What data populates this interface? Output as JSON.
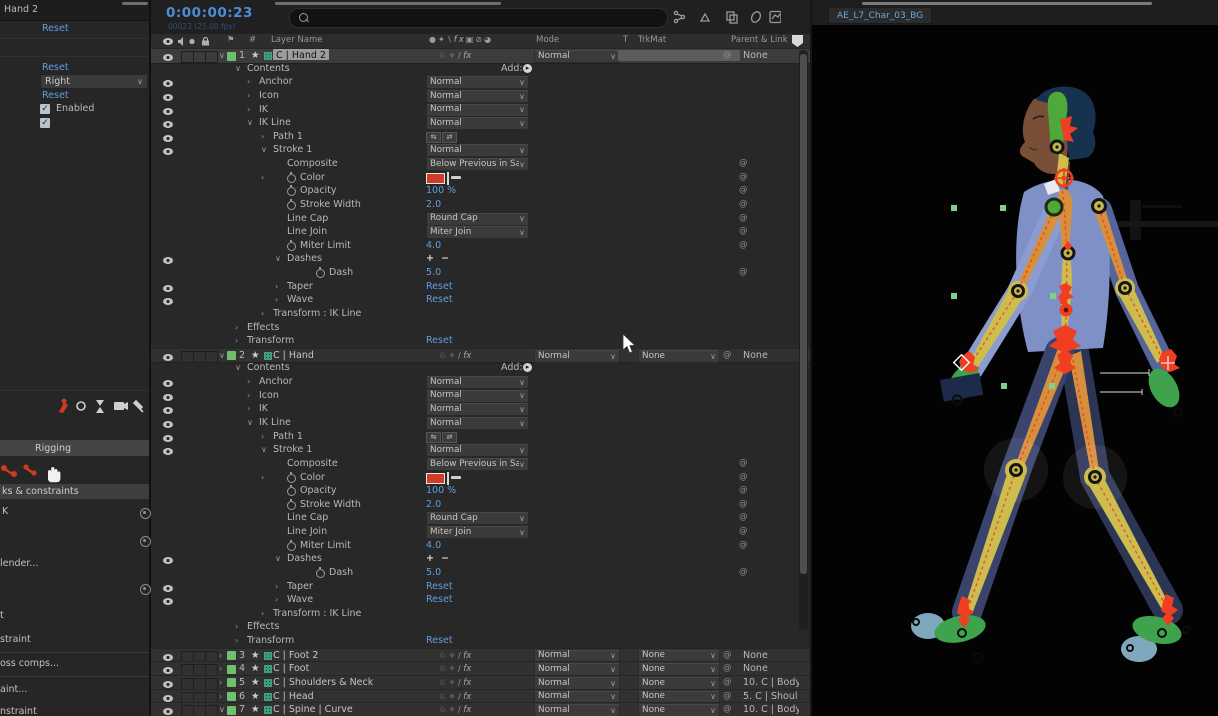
{
  "colors": {
    "accent_blue": "#4a8fd6",
    "value_blue": "#5f9fe0",
    "label_green": "#6fbf6f",
    "stroke_red": "#d23a2a",
    "controller_red": "#f03e22",
    "bone_orange": "#d68f3c",
    "bone_yellow": "#cdbc4e",
    "bone_green": "#4ea83a",
    "foot_green": "#3fa34d",
    "heel_blue": "#7fa8bd",
    "suit_blue": "#7e90c6"
  },
  "left_panel": {
    "title": "Hand 2",
    "reset1": "Reset",
    "reset2": "Reset",
    "reset3": "Reset",
    "dropdown_value": "Right",
    "checkbox_label": "Enabled",
    "tab_rigging": "Rigging",
    "tab_links": "ks & constraints",
    "items": [
      {
        "label": "K"
      },
      {
        "label": ""
      },
      {
        "label": "lender..."
      },
      {
        "label": ""
      },
      {
        "label": "t"
      },
      {
        "label": "straint"
      },
      {
        "label": "oss comps..."
      },
      {
        "label": "aint..."
      },
      {
        "label": "nstraint"
      }
    ]
  },
  "timeline": {
    "timecode": "0:00:00:23",
    "timecode_sub": "00023 (25.00 fps)",
    "columns": {
      "layer_name": "Layer Name",
      "mode": "Mode",
      "t": "T",
      "trkmat": "TrkMat",
      "parent": "Parent & Link",
      "hash": "#"
    },
    "add_label": "Add:",
    "rows": [
      {
        "t": "layer",
        "n": "1",
        "l": "C | Hand 2",
        "sel": true,
        "e": true,
        "tw": "open",
        "m": "Normal",
        "tksel": true,
        "pr": "None"
      },
      {
        "t": "contents",
        "l": "Contents",
        "tw": "open",
        "add": true
      },
      {
        "t": "group",
        "l": "Anchor",
        "i": "c3",
        "e": true,
        "tw": "closed",
        "v": {
          "k": "mode",
          "x": "Normal"
        }
      },
      {
        "t": "group",
        "l": "Icon",
        "i": "c3",
        "e": true,
        "tw": "closed",
        "v": {
          "k": "mode",
          "x": "Normal"
        }
      },
      {
        "t": "group",
        "l": "IK",
        "i": "c3",
        "e": true,
        "tw": "closed",
        "v": {
          "k": "mode",
          "x": "Normal"
        }
      },
      {
        "t": "group",
        "l": "IK Line",
        "i": "c3",
        "e": true,
        "tw": "open",
        "v": {
          "k": "mode",
          "x": "Normal"
        }
      },
      {
        "t": "group",
        "l": "Path 1",
        "i": "c4",
        "e": true,
        "tw": "closed",
        "v": {
          "k": "path"
        }
      },
      {
        "t": "group",
        "l": "Stroke 1",
        "i": "c4",
        "e": true,
        "tw": "open",
        "v": {
          "k": "mode",
          "x": "Normal"
        }
      },
      {
        "t": "prop",
        "l": "Composite",
        "i": "c5",
        "v": {
          "k": "dd",
          "x": "Below Previous in Sa"
        },
        "p": true
      },
      {
        "t": "prop",
        "l": "Color",
        "i": "c5",
        "tw": "closed",
        "sw": true,
        "v": {
          "k": "swatch"
        },
        "p": true
      },
      {
        "t": "prop",
        "l": "Opacity",
        "i": "c5",
        "sw": true,
        "v": {
          "k": "num",
          "x": "100 %"
        },
        "p": true
      },
      {
        "t": "prop",
        "l": "Stroke Width",
        "i": "c5",
        "sw": true,
        "v": {
          "k": "num",
          "x": "2.0"
        },
        "p": true
      },
      {
        "t": "prop",
        "l": "Line Cap",
        "i": "c5",
        "v": {
          "k": "dd",
          "x": "Round Cap"
        },
        "p": true
      },
      {
        "t": "prop",
        "l": "Line Join",
        "i": "c5",
        "v": {
          "k": "dd",
          "x": "Miter Join"
        },
        "p": true
      },
      {
        "t": "prop",
        "l": "Miter Limit",
        "i": "c5",
        "sw": true,
        "v": {
          "k": "num",
          "x": "4.0"
        },
        "p": true
      },
      {
        "t": "group",
        "l": "Dashes",
        "i": "c5",
        "e": true,
        "tw": "open",
        "v": {
          "k": "pm"
        }
      },
      {
        "t": "prop",
        "l": "Dash",
        "i": "c6",
        "sw": true,
        "v": {
          "k": "num",
          "x": "5.0"
        },
        "p": true
      },
      {
        "t": "group",
        "l": "Taper",
        "i": "c5",
        "e": true,
        "tw": "closed",
        "v": {
          "k": "reset"
        }
      },
      {
        "t": "group",
        "l": "Wave",
        "i": "c5",
        "e": true,
        "tw": "closed",
        "v": {
          "k": "reset"
        }
      },
      {
        "t": "group",
        "l": "Transform : IK Line",
        "i": "c4",
        "tw": "closed"
      },
      {
        "t": "group",
        "l": "Effects",
        "i": "c2",
        "tw": "closed"
      },
      {
        "t": "group",
        "l": "Transform",
        "i": "c2",
        "tw": "closed",
        "v": {
          "k": "reset"
        }
      },
      {
        "t": "layer",
        "n": "2",
        "l": "C | Hand",
        "e": true,
        "tw": "open",
        "m": "Normal",
        "tk": "None",
        "pr": "None"
      },
      {
        "t": "contents",
        "l": "Contents",
        "tw": "open",
        "add": true
      },
      {
        "t": "group",
        "l": "Anchor",
        "i": "c3",
        "e": true,
        "tw": "closed",
        "v": {
          "k": "mode",
          "x": "Normal"
        }
      },
      {
        "t": "group",
        "l": "Icon",
        "i": "c3",
        "e": true,
        "tw": "closed",
        "v": {
          "k": "mode",
          "x": "Normal"
        }
      },
      {
        "t": "group",
        "l": "IK",
        "i": "c3",
        "e": true,
        "tw": "closed",
        "v": {
          "k": "mode",
          "x": "Normal"
        }
      },
      {
        "t": "group",
        "l": "IK Line",
        "i": "c3",
        "e": true,
        "tw": "open",
        "v": {
          "k": "mode",
          "x": "Normal"
        }
      },
      {
        "t": "group",
        "l": "Path 1",
        "i": "c4",
        "e": true,
        "tw": "closed",
        "v": {
          "k": "path"
        }
      },
      {
        "t": "group",
        "l": "Stroke 1",
        "i": "c4",
        "e": true,
        "tw": "open",
        "v": {
          "k": "mode",
          "x": "Normal"
        }
      },
      {
        "t": "prop",
        "l": "Composite",
        "i": "c5",
        "v": {
          "k": "dd",
          "x": "Below Previous in Sa"
        },
        "p": true
      },
      {
        "t": "prop",
        "l": "Color",
        "i": "c5",
        "tw": "closed",
        "sw": true,
        "v": {
          "k": "swatch"
        },
        "p": true
      },
      {
        "t": "prop",
        "l": "Opacity",
        "i": "c5",
        "sw": true,
        "v": {
          "k": "num",
          "x": "100 %"
        },
        "p": true
      },
      {
        "t": "prop",
        "l": "Stroke Width",
        "i": "c5",
        "sw": true,
        "v": {
          "k": "num",
          "x": "2.0"
        },
        "p": true
      },
      {
        "t": "prop",
        "l": "Line Cap",
        "i": "c5",
        "v": {
          "k": "dd",
          "x": "Round Cap"
        },
        "p": true
      },
      {
        "t": "prop",
        "l": "Line Join",
        "i": "c5",
        "v": {
          "k": "dd",
          "x": "Miter Join"
        },
        "p": true
      },
      {
        "t": "prop",
        "l": "Miter Limit",
        "i": "c5",
        "sw": true,
        "v": {
          "k": "num",
          "x": "4.0"
        },
        "p": true
      },
      {
        "t": "group",
        "l": "Dashes",
        "i": "c5",
        "e": true,
        "tw": "open",
        "v": {
          "k": "pm"
        }
      },
      {
        "t": "prop",
        "l": "Dash",
        "i": "c6",
        "sw": true,
        "v": {
          "k": "num",
          "x": "5.0"
        },
        "p": true
      },
      {
        "t": "group",
        "l": "Taper",
        "i": "c5",
        "e": true,
        "tw": "closed",
        "v": {
          "k": "reset"
        }
      },
      {
        "t": "group",
        "l": "Wave",
        "i": "c5",
        "e": true,
        "tw": "closed",
        "v": {
          "k": "reset"
        }
      },
      {
        "t": "group",
        "l": "Transform : IK Line",
        "i": "c4",
        "tw": "closed"
      },
      {
        "t": "group",
        "l": "Effects",
        "i": "c2",
        "tw": "closed"
      },
      {
        "t": "group",
        "l": "Transform",
        "i": "c2",
        "tw": "closed",
        "v": {
          "k": "reset"
        }
      },
      {
        "t": "layer",
        "n": "3",
        "l": "C | Foot 2",
        "e": true,
        "tw": "closed",
        "m": "Normal",
        "tk": "None",
        "pr": "None"
      },
      {
        "t": "layer",
        "n": "4",
        "l": "C | Foot",
        "e": true,
        "tw": "closed",
        "m": "Normal",
        "tk": "None",
        "pr": "None"
      },
      {
        "t": "layer",
        "n": "5",
        "l": "C | Shoulders & Neck",
        "e": true,
        "tw": "closed",
        "m": "Normal",
        "tk": "None",
        "pr": "10. C | Body"
      },
      {
        "t": "layer",
        "n": "6",
        "l": "C | Head",
        "e": true,
        "tw": "closed",
        "m": "Normal",
        "tk": "None",
        "pr": "5. C | Shoul"
      },
      {
        "t": "layer",
        "n": "7",
        "l": "C | Spine | Curve",
        "e": true,
        "tw": "open",
        "m": "Normal",
        "tk": "None",
        "pr": "10. C | Body"
      }
    ]
  },
  "viewer": {
    "tab": "AE_L7_Char_03_BG"
  }
}
